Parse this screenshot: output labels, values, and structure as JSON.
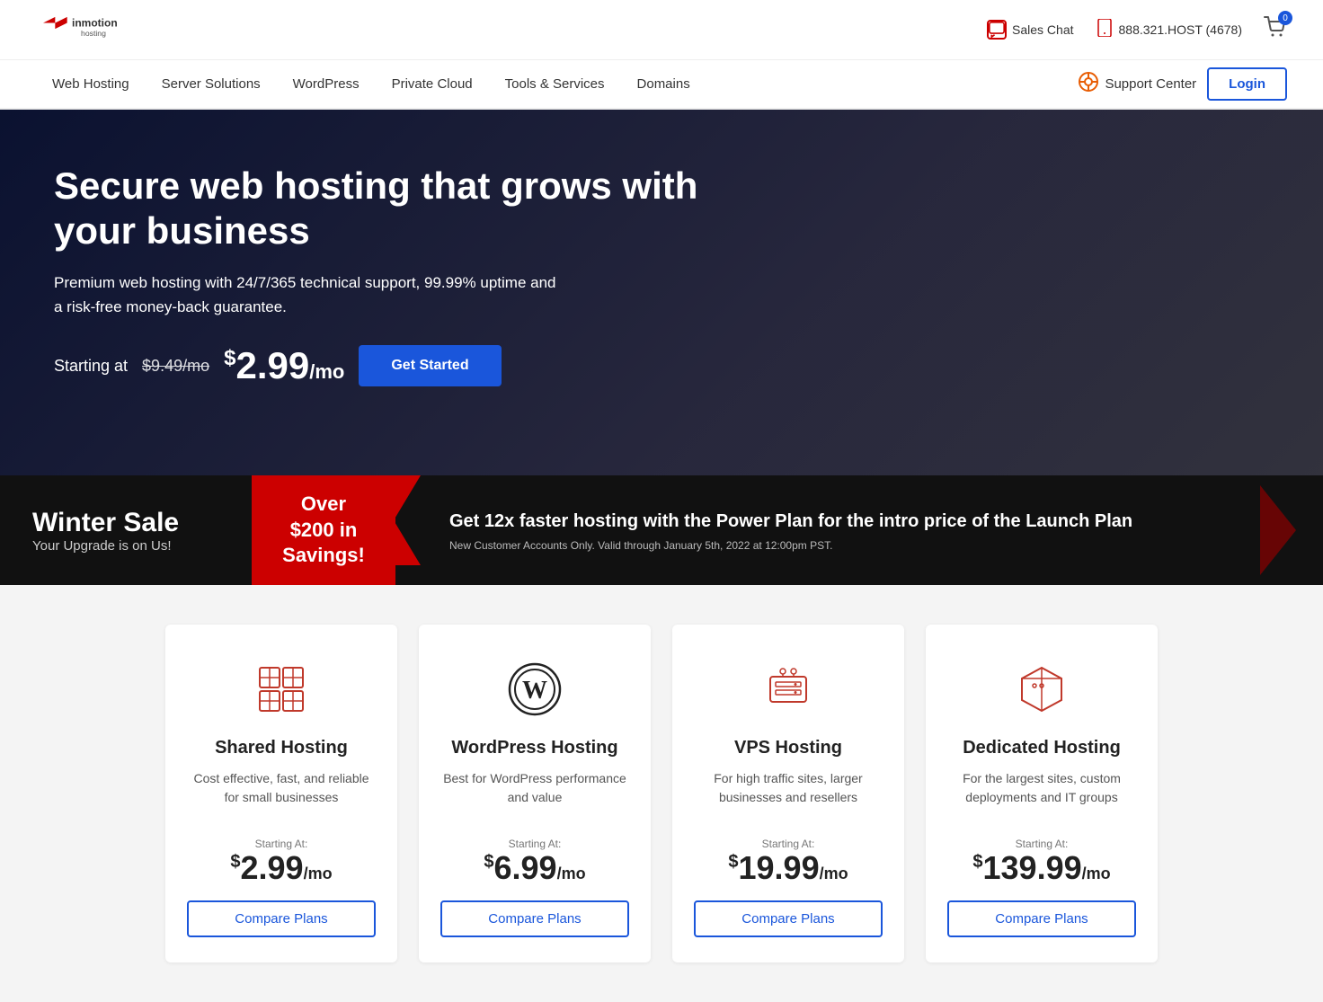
{
  "header": {
    "logo_alt": "InMotion Hosting",
    "sales_chat_label": "Sales Chat",
    "phone_number": "888.321.HOST (4678)",
    "cart_count": "0"
  },
  "nav": {
    "items": [
      {
        "label": "Web Hosting",
        "id": "web-hosting"
      },
      {
        "label": "Server Solutions",
        "id": "server-solutions"
      },
      {
        "label": "WordPress",
        "id": "wordpress"
      },
      {
        "label": "Private Cloud",
        "id": "private-cloud"
      },
      {
        "label": "Tools & Services",
        "id": "tools-services"
      },
      {
        "label": "Domains",
        "id": "domains"
      }
    ],
    "support_center_label": "Support Center",
    "login_label": "Login"
  },
  "hero": {
    "headline": "Secure web hosting that grows with your business",
    "subheadline": "Premium web hosting with 24/7/365 technical support, 99.99% uptime and a risk-free money-back guarantee.",
    "starting_at": "Starting at",
    "price_old": "$9.49/mo",
    "price_dollar": "$",
    "price_amount": "2.99",
    "price_unit": "/mo",
    "cta_label": "Get Started"
  },
  "winter_sale": {
    "title": "Winter Sale",
    "subtitle": "Your Upgrade is on Us!",
    "badge_line1": "Over",
    "badge_line2": "$200 in",
    "badge_line3": "Savings!",
    "promo_title": "Get 12x faster hosting with the Power Plan for the intro price of the Launch Plan",
    "promo_fine_print": "New Customer Accounts Only. Valid through January 5th, 2022 at 12:00pm PST."
  },
  "hosting_cards": [
    {
      "id": "shared",
      "title": "Shared Hosting",
      "description": "Cost effective, fast, and reliable for small businesses",
      "starting_at_label": "Starting At:",
      "price_dollar": "$",
      "price_amount": "2.99",
      "price_unit": "/mo",
      "cta_label": "Compare Plans",
      "icon_type": "cube-outline"
    },
    {
      "id": "wordpress",
      "title": "WordPress Hosting",
      "description": "Best for WordPress performance and value",
      "starting_at_label": "Starting At:",
      "price_dollar": "$",
      "price_amount": "6.99",
      "price_unit": "/mo",
      "cta_label": "Compare Plans",
      "icon_type": "wordpress"
    },
    {
      "id": "vps",
      "title": "VPS Hosting",
      "description": "For high traffic sites, larger businesses and resellers",
      "starting_at_label": "Starting At:",
      "price_dollar": "$",
      "price_amount": "19.99",
      "price_unit": "/mo",
      "cta_label": "Compare Plans",
      "icon_type": "server-outline"
    },
    {
      "id": "dedicated",
      "title": "Dedicated Hosting",
      "description": "For the largest sites, custom deployments and IT groups",
      "starting_at_label": "Starting At:",
      "price_dollar": "$",
      "price_amount": "139.99",
      "price_unit": "/mo",
      "cta_label": "Compare Plans",
      "icon_type": "server-box"
    }
  ]
}
